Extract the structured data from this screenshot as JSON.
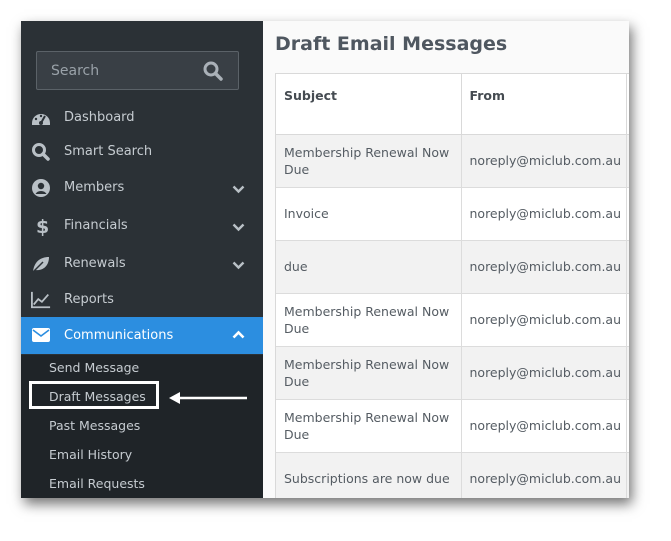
{
  "search": {
    "placeholder": "Search"
  },
  "sidebar": {
    "items": [
      {
        "label": "Dashboard",
        "icon": "dashboard-icon"
      },
      {
        "label": "Smart Search",
        "icon": "search-icon"
      },
      {
        "label": "Members",
        "icon": "user-icon",
        "expandable": true
      },
      {
        "label": "Financials",
        "icon": "dollar-icon",
        "expandable": true
      },
      {
        "label": "Renewals",
        "icon": "leaf-icon",
        "expandable": true
      },
      {
        "label": "Reports",
        "icon": "line-chart-icon"
      },
      {
        "label": "Communications",
        "icon": "envelope-icon",
        "expanded": true,
        "active": true
      }
    ],
    "submenu": [
      {
        "label": "Send Message"
      },
      {
        "label": "Draft Messages",
        "highlighted": true
      },
      {
        "label": "Past Messages"
      },
      {
        "label": "Email History"
      },
      {
        "label": "Email Requests"
      }
    ]
  },
  "main": {
    "title": "Draft Email Messages",
    "table": {
      "headers": [
        "Subject",
        "From",
        ""
      ],
      "rows": [
        {
          "subject": "Membership Renewal Now Due",
          "from": "noreply@miclub.com.au"
        },
        {
          "subject": "Invoice",
          "from": "noreply@miclub.com.au"
        },
        {
          "subject": "due",
          "from": "noreply@miclub.com.au"
        },
        {
          "subject": "Membership Renewal Now Due",
          "from": "noreply@miclub.com.au"
        },
        {
          "subject": "Membership Renewal Now Due",
          "from": "noreply@miclub.com.au"
        },
        {
          "subject": "Membership Renewal Now Due",
          "from": "noreply@miclub.com.au"
        },
        {
          "subject": "Subscriptions are now due",
          "from": "noreply@miclub.com.au"
        }
      ]
    }
  },
  "colors": {
    "sidebar_bg": "#2b3136",
    "submenu_bg": "#1f2428",
    "accent": "#2c8ee0",
    "text_light": "#c6ccd1"
  }
}
